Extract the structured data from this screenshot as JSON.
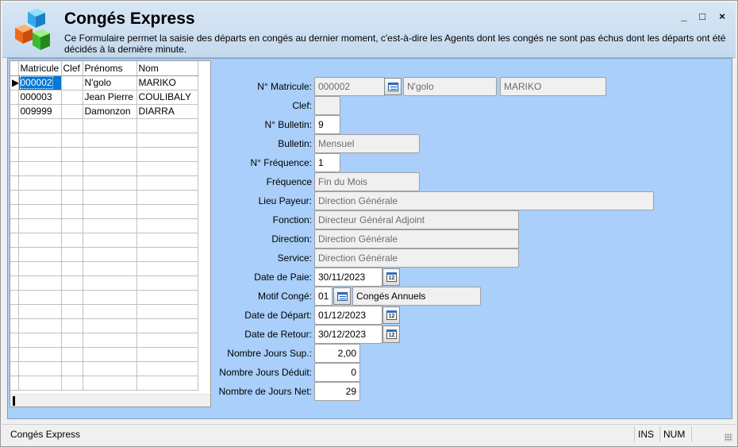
{
  "window": {
    "title": "Congés Express",
    "description": "Ce Formulaire permet la saisie des départs en congés au dernier moment, c'est-à-dire les Agents dont les congés ne sont pas échus dont les départs ont été décidés à la dernière minute.",
    "controls": {
      "minimize": "_",
      "maximize": "□",
      "close": "×"
    },
    "logo_icon": "colored-cubes-icon"
  },
  "grid": {
    "columns": [
      "Matricule",
      "Clef",
      "Prénoms",
      "Nom"
    ],
    "rows": [
      {
        "matricule": "000002",
        "clef": "",
        "prenoms": "N'golo",
        "nom": "MARIKO"
      },
      {
        "matricule": "000003",
        "clef": "",
        "prenoms": "Jean Pierre",
        "nom": "COULIBALY"
      },
      {
        "matricule": "009999",
        "clef": "",
        "prenoms": "Damonzon",
        "nom": "DIARRA"
      }
    ],
    "selected_row_marker": "▶"
  },
  "form": {
    "matricule": {
      "label": "N° Matricule:",
      "value": "000002",
      "prenom": "N'golo",
      "nom": "MARIKO"
    },
    "clef": {
      "label": "Clef:",
      "value": ""
    },
    "bulletin_no": {
      "label": "N° Bulletin:",
      "value": "9"
    },
    "bulletin": {
      "label": "Bulletin:",
      "value": "Mensuel"
    },
    "frequence_no": {
      "label": "N° Fréquence:",
      "value": "1"
    },
    "frequence": {
      "label": "Fréquence",
      "value": "Fin du Mois"
    },
    "lieu_payeur": {
      "label": "Lieu Payeur:",
      "value": "Direction Générale"
    },
    "fonction": {
      "label": "Fonction:",
      "value": "Directeur Général Adjoint"
    },
    "direction": {
      "label": "Direction:",
      "value": "Direction Générale"
    },
    "service": {
      "label": "Service:",
      "value": "Direction Générale"
    },
    "date_paie": {
      "label": "Date de Paie:",
      "value": "30/11/2023"
    },
    "motif_conge": {
      "label": "Motif Congé:",
      "code": "01",
      "value": "Congés Annuels"
    },
    "date_depart": {
      "label": "Date de Départ:",
      "value": "01/12/2023"
    },
    "date_retour": {
      "label": "Date de Retour:",
      "value": "30/12/2023"
    },
    "jours_sup": {
      "label": "Nombre Jours Sup.:",
      "value": "2,00"
    },
    "jours_deduit": {
      "label": "Nombre Jours Déduit:",
      "value": "0"
    },
    "jours_net": {
      "label": "Nombre de Jours Net:",
      "value": "29"
    },
    "calendar_icon_text": "12"
  },
  "status": {
    "text": "Congés Express",
    "ins": "INS",
    "num": "NUM"
  }
}
